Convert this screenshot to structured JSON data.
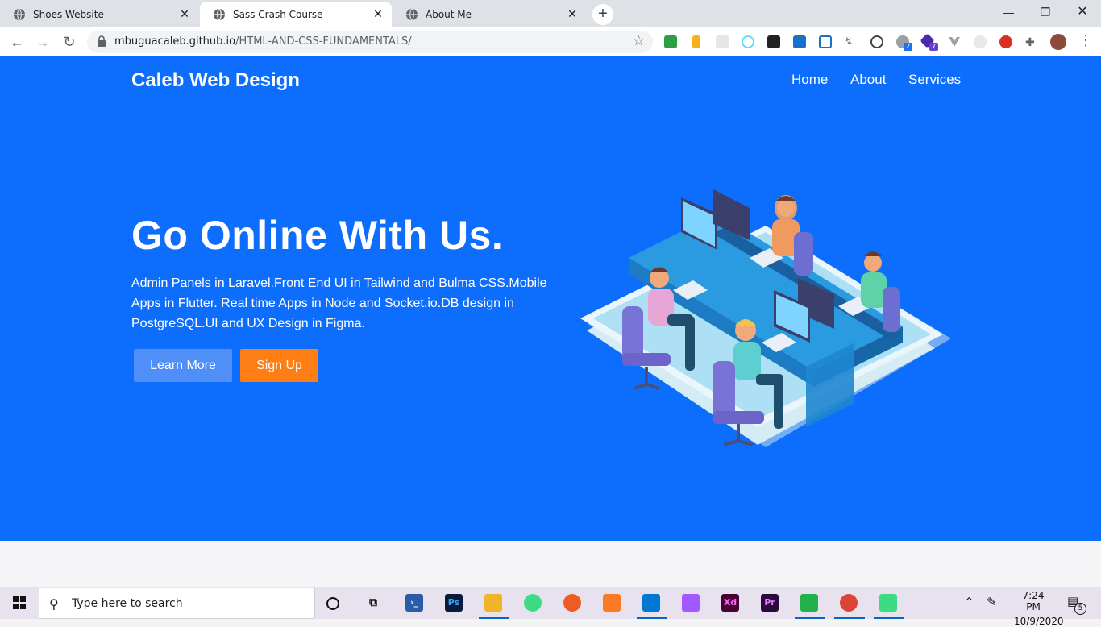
{
  "browser": {
    "tabs": [
      {
        "title": "Shoes Website",
        "active": false
      },
      {
        "title": "Sass Crash Course",
        "active": true
      },
      {
        "title": "About Me",
        "active": false
      }
    ],
    "url_host": "mbuguacaleb.github.io",
    "url_path": "/HTML-AND-CSS-FUNDAMENTALS/",
    "extension_badges": {
      "ext1": "2",
      "ext2": "7"
    }
  },
  "site": {
    "brand": "Caleb Web Design",
    "nav": [
      "Home",
      "About",
      "Services"
    ],
    "headline": "Go Online With Us.",
    "description": "Admin Panels in Laravel.Front End UI in Tailwind and Bulma CSS.Mobile Apps in Flutter. Real time Apps in Node and Socket.io.DB design in PostgreSQL.UI and UX Design in Figma.",
    "buttons": {
      "learn_more": "Learn More",
      "sign_up": "Sign Up"
    },
    "colors": {
      "hero_bg": "#0d6efd",
      "learn_more_bg": "#4f8ff7",
      "sign_up_bg": "#fd7e14"
    }
  },
  "taskbar": {
    "search_placeholder": "Type here to search",
    "time": "7:24 PM",
    "date": "10/9/2020",
    "notification_count": "5",
    "apps": [
      "cortana-icon",
      "task-view-icon",
      "powershell-icon",
      "photoshop-icon",
      "file-explorer-icon",
      "android-studio-icon",
      "postman-icon",
      "xampp-icon",
      "vscode-icon",
      "figma-icon",
      "adobe-xd-icon",
      "premiere-pro-icon",
      "green-app-icon",
      "chrome-icon",
      "android-emulator-icon"
    ]
  }
}
